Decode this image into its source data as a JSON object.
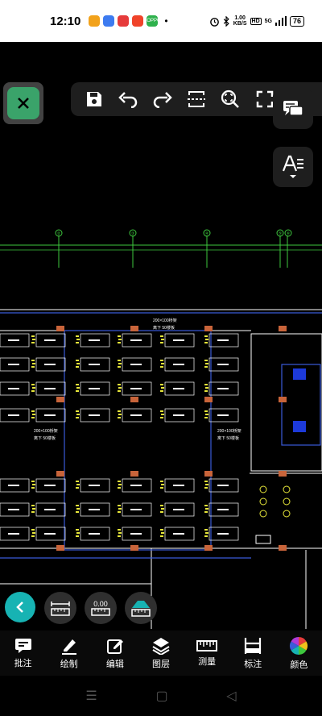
{
  "status_bar": {
    "time": "12:10",
    "dot": "•",
    "net_speed_value": "1.00",
    "net_speed_unit": "KB/S",
    "hd": "HD",
    "network": "5G",
    "battery": "76",
    "app_icons": [
      {
        "name": "app-icon-1",
        "color": "#f2a21b"
      },
      {
        "name": "app-icon-2",
        "color": "#3d7bf0"
      },
      {
        "name": "app-icon-3",
        "color": "#e63b3b"
      },
      {
        "name": "app-icon-4",
        "color": "#f0432a"
      },
      {
        "name": "app-icon-5",
        "color": "#2eb14c",
        "text": "OPPO"
      }
    ]
  },
  "toolbar": {
    "icons": [
      "save-icon",
      "undo-icon",
      "redo-icon",
      "fit-view-icon",
      "zoom-icon",
      "fullscreen-icon",
      "more-icon"
    ]
  },
  "floating_tools": {
    "distance_value": "0.00"
  },
  "bottom_nav": {
    "items": [
      {
        "label": "批注",
        "icon": "comment-icon"
      },
      {
        "label": "绘制",
        "icon": "pen-icon"
      },
      {
        "label": "编辑",
        "icon": "edit-icon"
      },
      {
        "label": "图层",
        "icon": "layers-icon"
      },
      {
        "label": "测量",
        "icon": "ruler-icon"
      },
      {
        "label": "标注",
        "icon": "dimension-icon"
      },
      {
        "label": "颜色",
        "icon": "color-wheel-icon"
      }
    ]
  },
  "drawing": {
    "axis_labels": [
      "②",
      "③",
      "④",
      "⑤",
      "⑥"
    ],
    "notes": [
      "200×100桥架",
      "离下 50楼板",
      "200×100桥架",
      "离下 50楼板"
    ]
  },
  "colors": {
    "toolbar_bg": "#1e1e1e",
    "accent_teal": "#17b3b3",
    "cad_green": "#3ec83e",
    "cad_yellow": "#e8e83a",
    "cad_blue": "#3a5bd9"
  }
}
